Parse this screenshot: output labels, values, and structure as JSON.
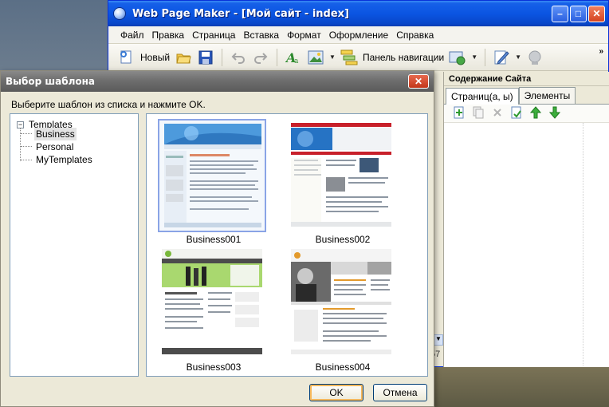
{
  "main_window": {
    "title": "Web Page Maker - [Мой сайт - index]",
    "menu": [
      "Файл",
      "Правка",
      "Страница",
      "Вставка",
      "Формат",
      "Оформление",
      "Справка"
    ],
    "toolbar": {
      "new_label": "Новый",
      "nav_panel_label": "Панель навигации",
      "overflow": "»"
    },
    "site_panel": {
      "header": "Содержание Сайта",
      "tabs": [
        "Страниц(а, ы)",
        "Элементы"
      ]
    },
    "edge_number": "57"
  },
  "dialog": {
    "title": "Выбор шаблона",
    "instruction": "Выберите шаблон из списка и нажмите OK.",
    "tree": {
      "root": "Templates",
      "toggle": "−",
      "children": [
        "Business",
        "Personal",
        "MyTemplates"
      ],
      "selected": "Business"
    },
    "templates": [
      {
        "name": "Business001",
        "selected": true
      },
      {
        "name": "Business002",
        "selected": false
      },
      {
        "name": "Business003",
        "selected": false
      },
      {
        "name": "Business004",
        "selected": false
      }
    ],
    "ok_label": "OK",
    "cancel_label": "Отмена",
    "close_glyph": "✕"
  }
}
